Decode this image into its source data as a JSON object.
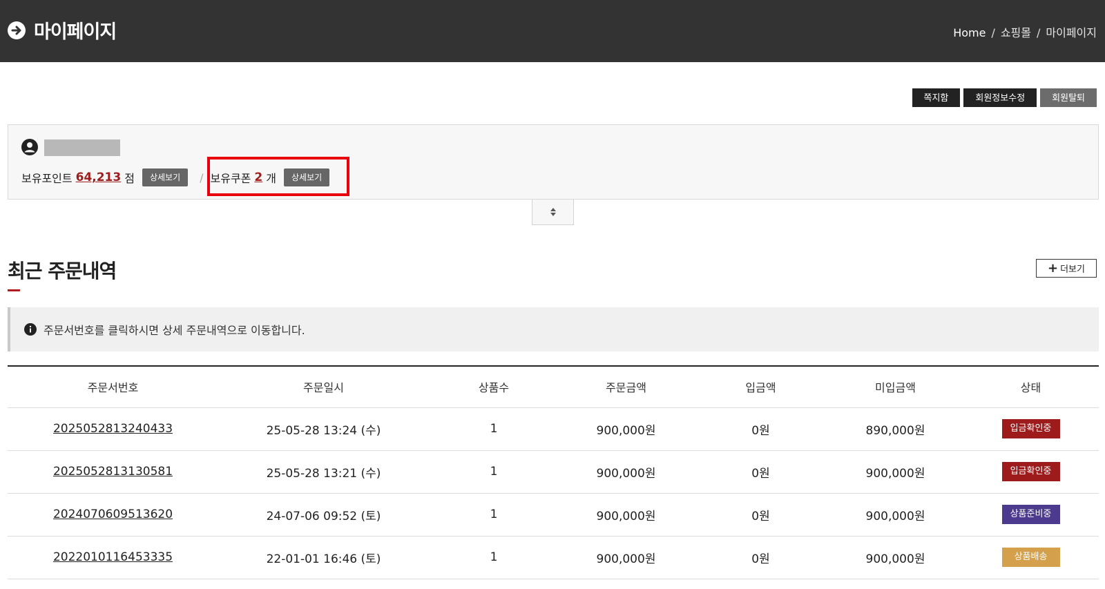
{
  "header": {
    "title": "마이페이지",
    "breadcrumb": [
      "Home",
      "쇼핑몰",
      "마이페이지"
    ]
  },
  "actions": [
    "쪽지함",
    "회원정보수정",
    "회원탈퇴"
  ],
  "profile": {
    "points_label": "보유포인트",
    "points_value": "64,213",
    "points_unit": "점",
    "detail_label": "상세보기",
    "coupon_label": "보유쿠폰",
    "coupon_value": "2",
    "coupon_unit": "개"
  },
  "recent_orders": {
    "title": "최근 주문내역",
    "more_label": "더보기",
    "notice": "주문서번호를 클릭하시면 상세 주문내역으로 이동합니다.",
    "columns": [
      "주문서번호",
      "주문일시",
      "상품수",
      "주문금액",
      "입금액",
      "미입금액",
      "상태"
    ],
    "rows": [
      {
        "order_no": "2025052813240433",
        "date": "25-05-28 13:24 (수)",
        "qty": "1",
        "amount": "900,000원",
        "paid": "0원",
        "unpaid": "890,000원",
        "status": "입금확인중",
        "status_color": "#9e1b1b"
      },
      {
        "order_no": "2025052813130581",
        "date": "25-05-28 13:21 (수)",
        "qty": "1",
        "amount": "900,000원",
        "paid": "0원",
        "unpaid": "900,000원",
        "status": "입금확인중",
        "status_color": "#9e1b1b"
      },
      {
        "order_no": "2024070609513620",
        "date": "24-07-06 09:52 (토)",
        "qty": "1",
        "amount": "900,000원",
        "paid": "0원",
        "unpaid": "900,000원",
        "status": "상품준비중",
        "status_color": "#4b3a8e"
      },
      {
        "order_no": "2022010116453335",
        "date": "22-01-01 16:46 (토)",
        "qty": "1",
        "amount": "900,000원",
        "paid": "0원",
        "unpaid": "900,000원",
        "status": "상품배송",
        "status_color": "#d4a04c"
      }
    ]
  },
  "colors": {
    "header_bg": "#333333",
    "accent_red": "#9d1c1c",
    "highlight": "#e8000c"
  }
}
